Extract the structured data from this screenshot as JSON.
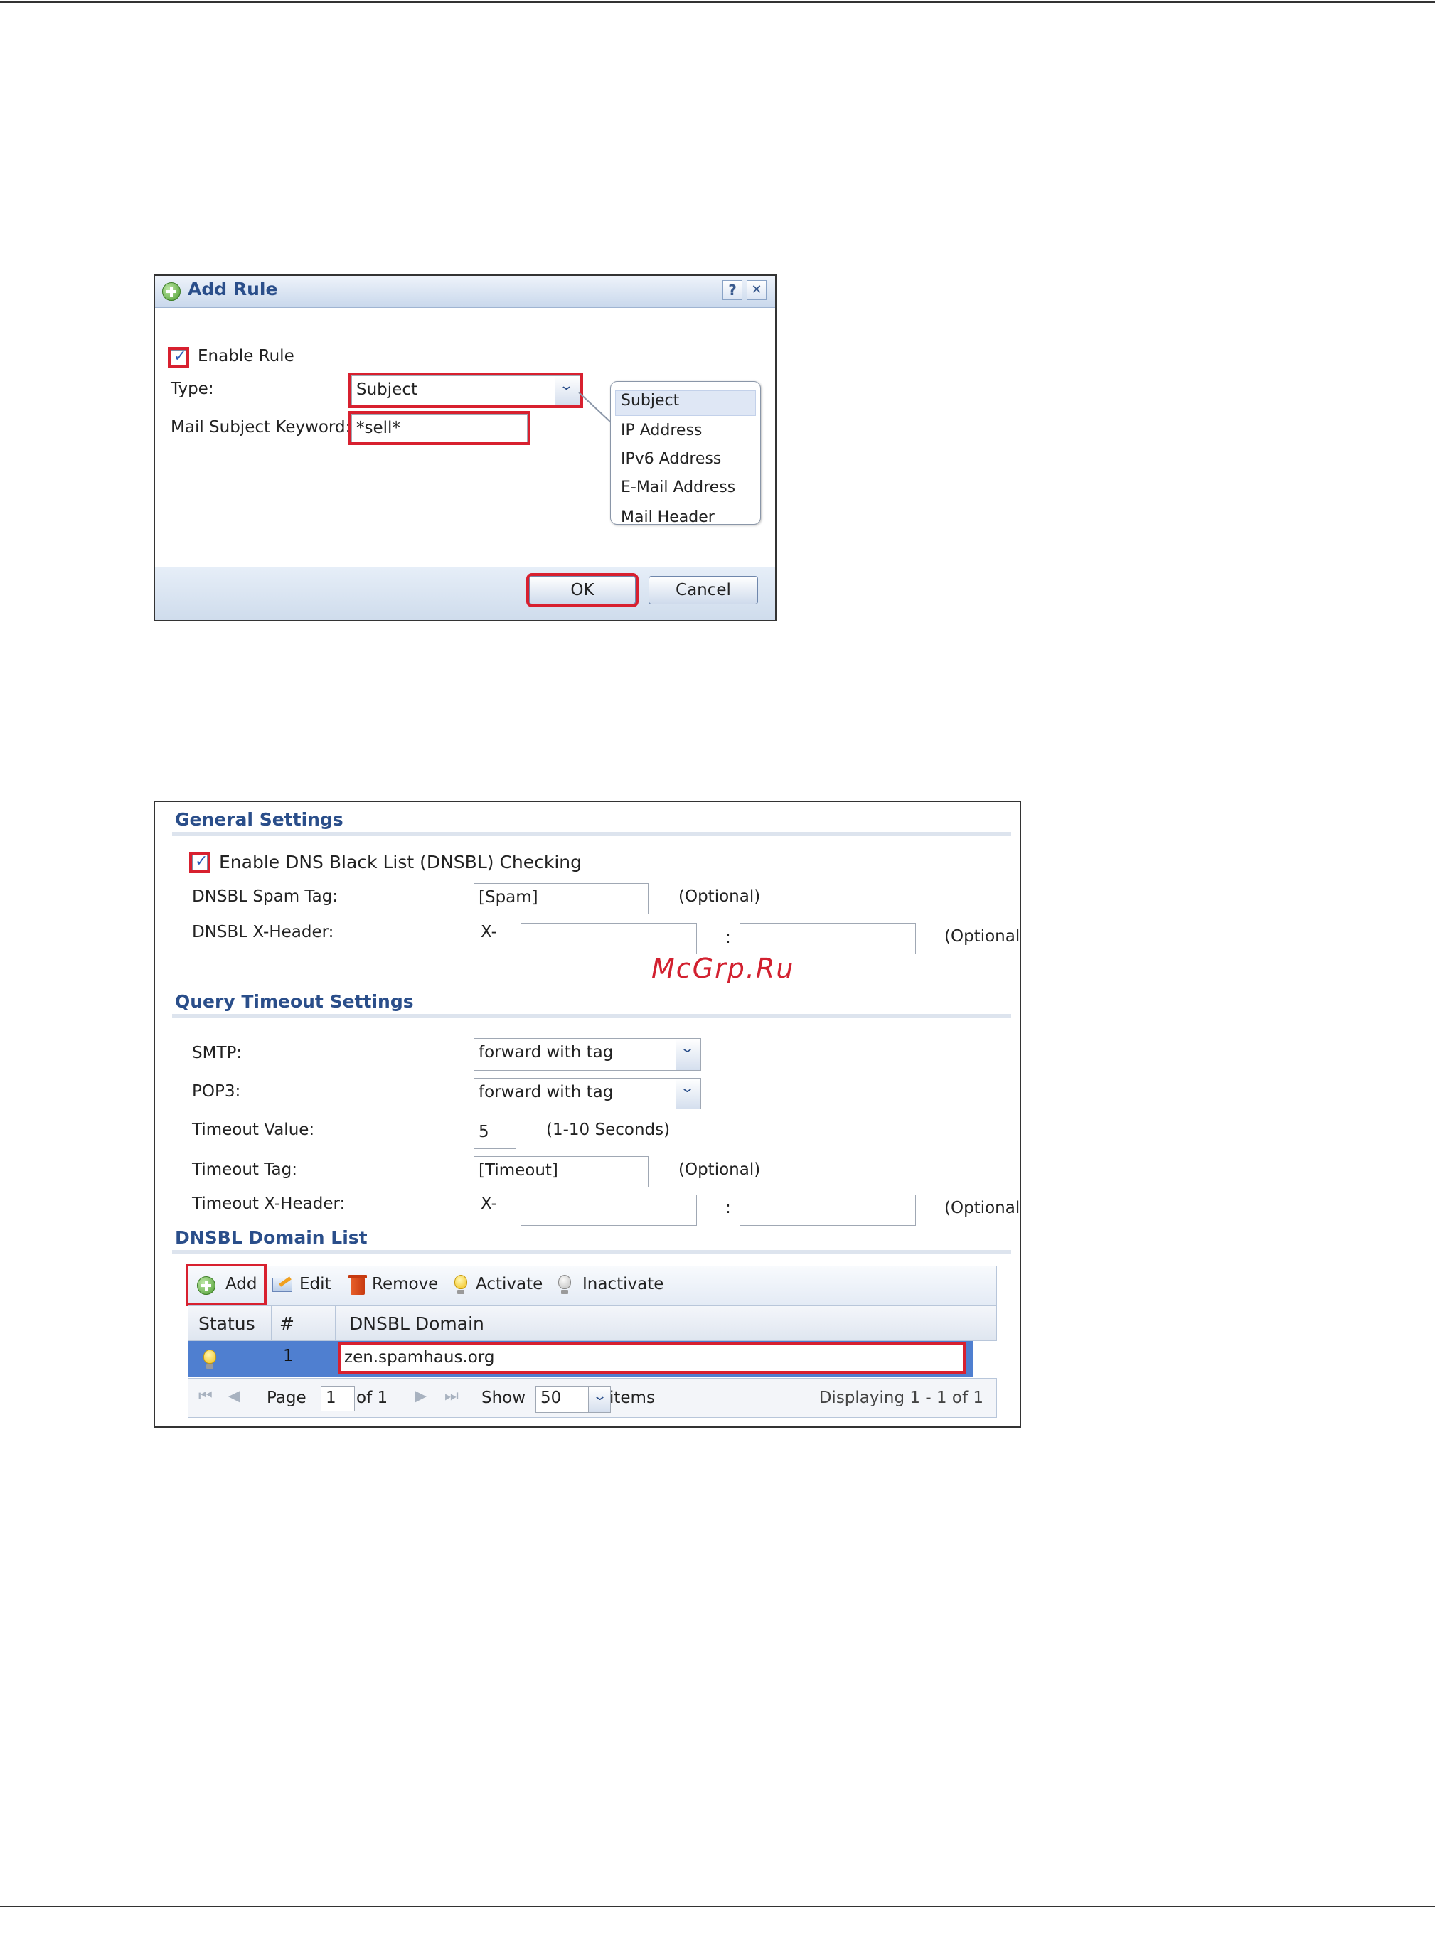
{
  "add_rule_dialog": {
    "title": "Add Rule",
    "help_button": "?",
    "close_button": "✕",
    "enable_rule_label": "Enable Rule",
    "enable_rule_checked": true,
    "type_label": "Type:",
    "type_value": "Subject",
    "keyword_label": "Mail Subject Keyword:",
    "keyword_value": "*sell*",
    "type_options": [
      "Subject",
      "IP Address",
      "IPv6 Address",
      "E-Mail Address",
      "Mail Header"
    ],
    "ok_label": "OK",
    "cancel_label": "Cancel"
  },
  "dnsbl_panel": {
    "general": {
      "title": "General Settings",
      "enable_label": "Enable DNS Black List (DNSBL) Checking",
      "enable_checked": true,
      "spam_tag_label": "DNSBL Spam Tag:",
      "spam_tag_value": "[Spam]",
      "spam_tag_hint": "(Optional)",
      "xheader_label": "DNSBL X-Header:",
      "xheader_prefix": "X-",
      "xheader_sep": ":",
      "xheader_hint": "(Optional)"
    },
    "watermark": "McGrp.Ru",
    "timeout": {
      "title": "Query Timeout Settings",
      "smtp_label": "SMTP:",
      "smtp_value": "forward with tag",
      "pop3_label": "POP3:",
      "pop3_value": "forward with tag",
      "value_label": "Timeout Value:",
      "value_value": "5",
      "value_hint": "(1-10 Seconds)",
      "tag_label": "Timeout Tag:",
      "tag_value": "[Timeout]",
      "tag_hint": "(Optional)",
      "xheader_label": "Timeout X-Header:",
      "xheader_prefix": "X-",
      "xheader_sep": ":",
      "xheader_hint": "(Optional)"
    },
    "domain_list": {
      "title": "DNSBL Domain List",
      "toolbar": {
        "add": "Add",
        "edit": "Edit",
        "remove": "Remove",
        "activate": "Activate",
        "inactivate": "Inactivate"
      },
      "columns": [
        "Status",
        "#",
        "DNSBL Domain"
      ],
      "rows": [
        {
          "index": "1",
          "domain": "zen.spamhaus.org",
          "status": "active"
        }
      ],
      "pager": {
        "page_label": "Page",
        "page_value": "1",
        "of_label": "of 1",
        "show_label": "Show",
        "show_value": "50",
        "items_label": "items",
        "displaying": "Displaying 1 - 1 of 1"
      }
    }
  }
}
